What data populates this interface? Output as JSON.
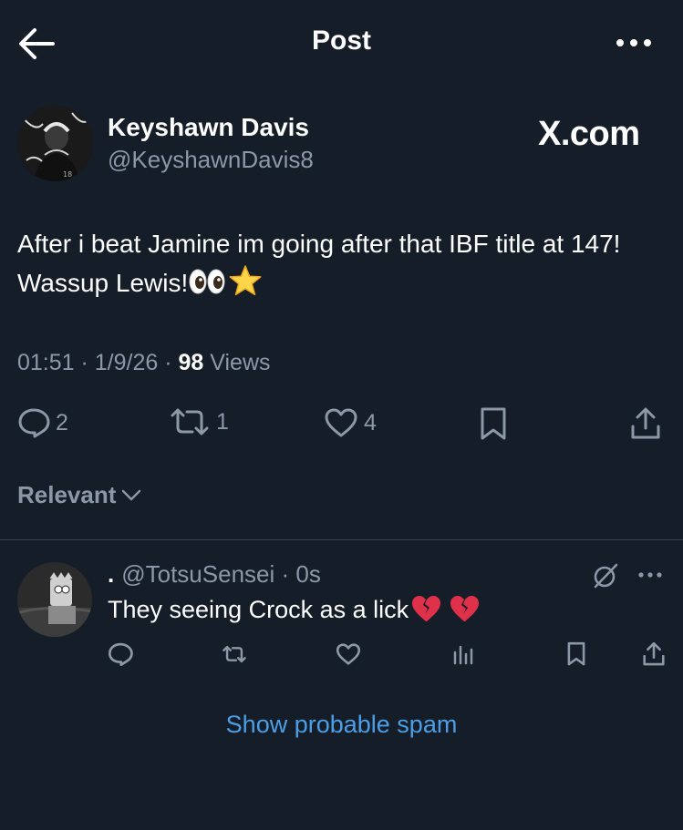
{
  "header": {
    "title": "Post",
    "back_icon": "arrow-left-icon",
    "more_icon": "more-horizontal-icon"
  },
  "post": {
    "display_name": "Keyshawn Davis",
    "handle": "@KeyshawnDavis8",
    "watermark": "X.com",
    "text": "After i beat Jamine im going after that IBF title at 147! Wassup Lewis!",
    "emojis": [
      "eyes",
      "star"
    ],
    "time": "01:51",
    "date": "1/9/26",
    "views_count": "98",
    "views_label": "Views",
    "replies": "2",
    "reposts": "1",
    "likes": "4"
  },
  "sort": {
    "label": "Relevant"
  },
  "reply": {
    "display_name": ".",
    "handle": "@TotsuSensei",
    "time": "0s",
    "text": "They seeing Crock as a lick",
    "emojis": [
      "broken-heart",
      "broken-heart"
    ]
  },
  "spam_link": "Show probable spam",
  "colors": {
    "background": "#151d28",
    "text": "#ffffff",
    "secondary": "#8b98a5",
    "link": "#4a9fe8",
    "divider": "#38444d"
  }
}
